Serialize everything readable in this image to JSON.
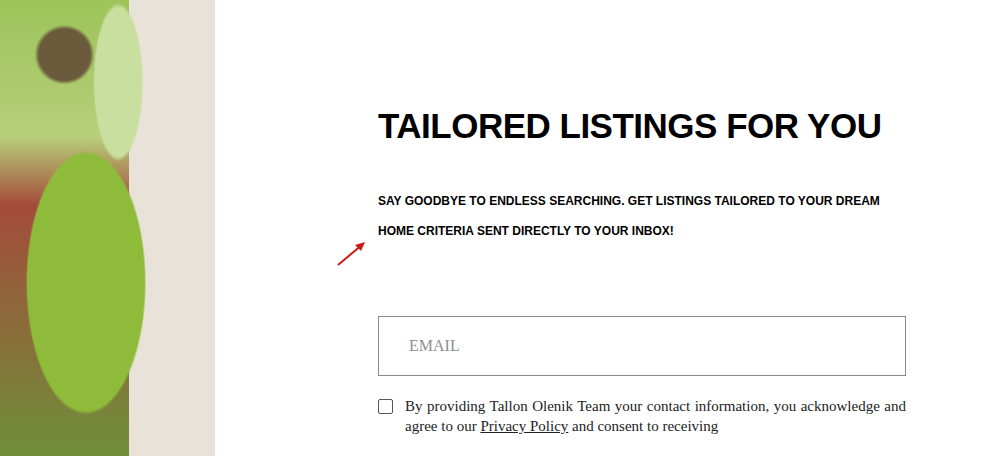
{
  "heading": "TAILORED LISTINGS FOR YOU",
  "subtitle": "SAY GOODBYE TO ENDLESS SEARCHING. GET LISTINGS TAILORED TO YOUR DREAM HOME CRITERIA SENT DIRECTLY TO YOUR INBOX!",
  "email": {
    "placeholder": "EMAIL"
  },
  "consent": {
    "checked": false,
    "before": "By providing Tallon Olenik Team your contact information, you acknowledge and agree to our ",
    "link": "Privacy Policy",
    "after": " and consent to receiving"
  }
}
